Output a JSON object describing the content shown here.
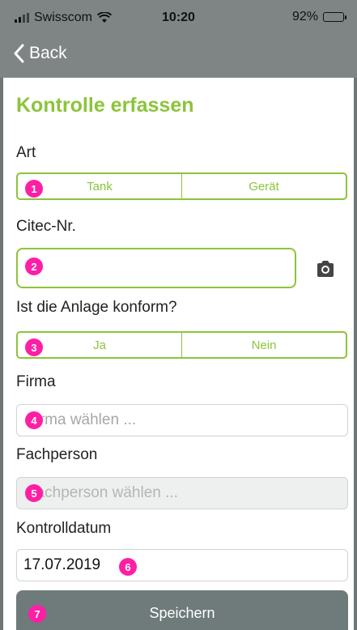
{
  "status": {
    "carrier": "Swisscom",
    "time": "10:20",
    "battery": "92%",
    "battery_level": 0.92
  },
  "nav": {
    "back_label": "Back"
  },
  "form": {
    "title": "Kontrolle erfassen",
    "art": {
      "label": "Art",
      "options": [
        "Tank",
        "Gerät"
      ]
    },
    "citec": {
      "label": "Citec-Nr.",
      "value": ""
    },
    "konform": {
      "label": "Ist die Anlage konform?",
      "options": [
        "Ja",
        "Nein"
      ]
    },
    "firma": {
      "label": "Firma",
      "placeholder": "Firma wählen ..."
    },
    "fachperson": {
      "label": "Fachperson",
      "placeholder": "Fachperson wählen ..."
    },
    "kontrolldatum": {
      "label": "Kontrolldatum",
      "value": "17.07.2019"
    },
    "save_label": "Speichern"
  },
  "badges": [
    "1",
    "2",
    "3",
    "4",
    "5",
    "6",
    "7"
  ],
  "colors": {
    "accent": "#8cc43a",
    "bar": "#7f8585",
    "button": "#6f7a7a",
    "badge": "#ff1ea6"
  }
}
